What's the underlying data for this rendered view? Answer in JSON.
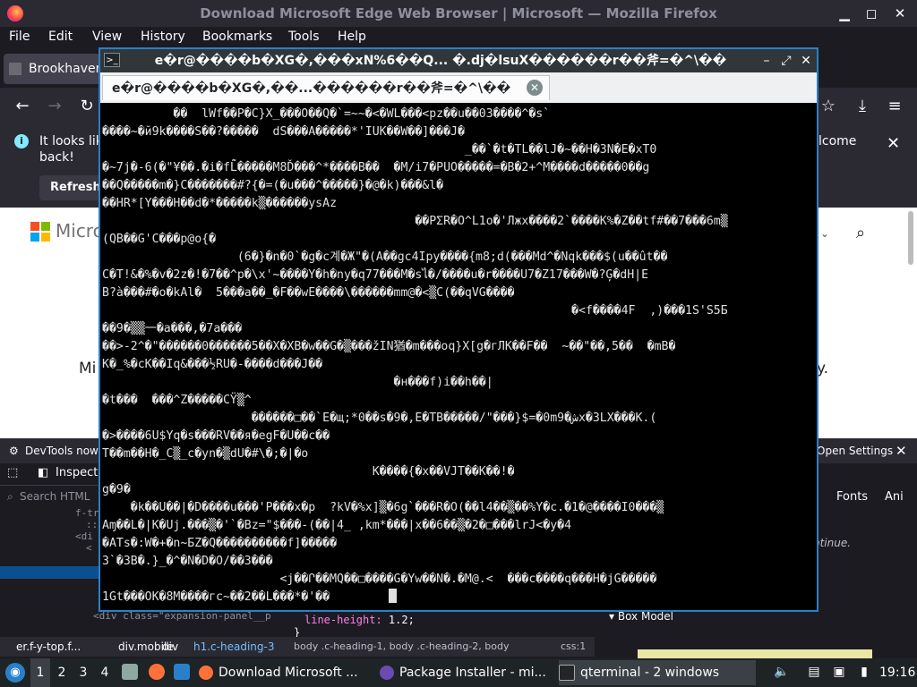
{
  "firefox": {
    "window_title": "Download Microsoft Edge Web Browser | Microsoft — Mozilla Firefox",
    "menu": [
      "File",
      "Edit",
      "View",
      "History",
      "Bookmarks",
      "Tools",
      "Help"
    ],
    "tab_label": "Brookhaven",
    "notification": {
      "text": "It looks lik",
      "text2": "back!",
      "right_text": "lcome",
      "button": "Refresh"
    },
    "page": {
      "logo_text": "Microsof",
      "mid_text_left": "Mi",
      "mid_text_right": "y."
    }
  },
  "devtools": {
    "notice": "DevTools now f",
    "open_settings": "Open Settings",
    "inspector_tab": "Inspecto",
    "search_placeholder": "Search HTML",
    "fonts_tab": "Fonts",
    "ani_tab": "Ani",
    "continue_text": "ntinue.",
    "tree_lines": [
      "f-tr",
      "::",
      "<di",
      "<",
      "",
      "",
      "",
      "",
      ""
    ],
    "expansion_line": "<div class=\"expansion-panel__p",
    "rule_line": "line-height: 1.2;",
    "rule_prop": "line-height:",
    "rule_val": " 1.2;",
    "rule_brace": "}",
    "css_strip": "body .c-heading-1, body .c-heading-2, body",
    "css_loc": "css:1",
    "breadcrumb": {
      "prefix": "er.f-y-top.f...",
      "b1": "div.mobile",
      "b2": "div",
      "current": "h1.c-heading-3"
    },
    "box_model": "Box Model"
  },
  "qterminal": {
    "title": "e�r@����b�XG�,���xN%6��Q...  �.dj�lsuX������r��斧=�^\\��",
    "tab_label": "e�r@����b�XG�,��...������r��斧=�^\\��",
    "lines": [
      "          ��  lWf��P�C}X_���O��Q�`=~~�<�WL���<pz��u��03����^�s`",
      "����~�й9k����S��?�����  dS���A�����*'IUK��W��]���J�",
      "                                                   _��`�t�TL��lJ�~��H�3N�E�xT0",
      "�~7j�-6(�\"¥��.�i�fL̇̃�����M8Ď���^*����B��  �M/i7�PUO�����=�B�2+^M����d�����0��g",
      "��Q�����m�}C�������#?{�=(�u���^�����}�@�k)���&l�",
      "��HR*[Y���H��d�*�����k▒������ysAz",
      "                                            ��PΣR�O^L1o�'Лжх����2`����K%�Z��tf#��7���6m▒",
      "(QB��G'C���p@o{�",
      "                   (6�}�n�0`�g�c계�Ж\"�(А��gc4Ipy����{m8;d(���Md^�Nqk���$(u��ût��",
      "C�T!&�%�v�2z�!�7��^p�\\x'~����Y�h�ny�q77���M�sไ�/����u�r����U7�Z17���W�?Ģ�dH|E",
      "B?à���#�o�kAl�  5���a��_�F��wE����\\������mm@�<▒C(��qVG����",
      "                                                                  �<f����4F  ,)���1S'S5Б",
      "��9�▒▒一�a���,�7a���",
      "��>-2^�\"������0������5��X�XB�w��G�▒���žIN猶�m���oq}X[g�гЛK��F��  ~��\"��,5��  �mB�",
      "K�_%�cK��Iq&���½RU�-����d���J��",
      "                                         �н���f)i��h��|",
      "�t���  ���^Z�����CŸ▒^",
      "                     ������□��`E�щ;*0��s�9�,E�TB�����/\"���}$=�0m9�شx�3LX���K.(",
      "�>����6U$Yq�s���RV��я�egF�U��c��",
      "T��m��H�_C▒_c�yn�▒dU�#\\�;�|�o",
      "                                      K����{�x��VJT��K��!�",
      "g�9�",
      "    �k��U��|�D����u���'P���x�p  ?kV�%x]▒�6g`���R�O(��l4��▒��%Y�c.�1�@����I0���▒",
      "Aɱ��L�|K�Uj.���▒�'`�Bz=\"$���-(��|4_ ,km*���|x��6��▒�2�□���lrJ<�y�4",
      "�ATs�:W�+�n~БZ�Q����������f]�����",
      "3`�3B�.}_�^�N�D�O/��3���",
      "                         <j��Ր��MQ��□����G�Yw��N�.�M@.<  ���c����q���H�jG�����",
      "1Gt���OK�8M����гc~��2��L���*�'��"
    ]
  },
  "taskbar": {
    "workspaces": [
      "1",
      "2",
      "3",
      "4"
    ],
    "tasks": [
      "Download Microsoft ...",
      "Package Installer - mi...",
      "qterminal - 2 windows"
    ],
    "clock": "19:16"
  },
  "colors": {
    "terminal_bg": "#000000",
    "terminal_fg": "#e0e0e0",
    "accent": "#2a80c8"
  }
}
